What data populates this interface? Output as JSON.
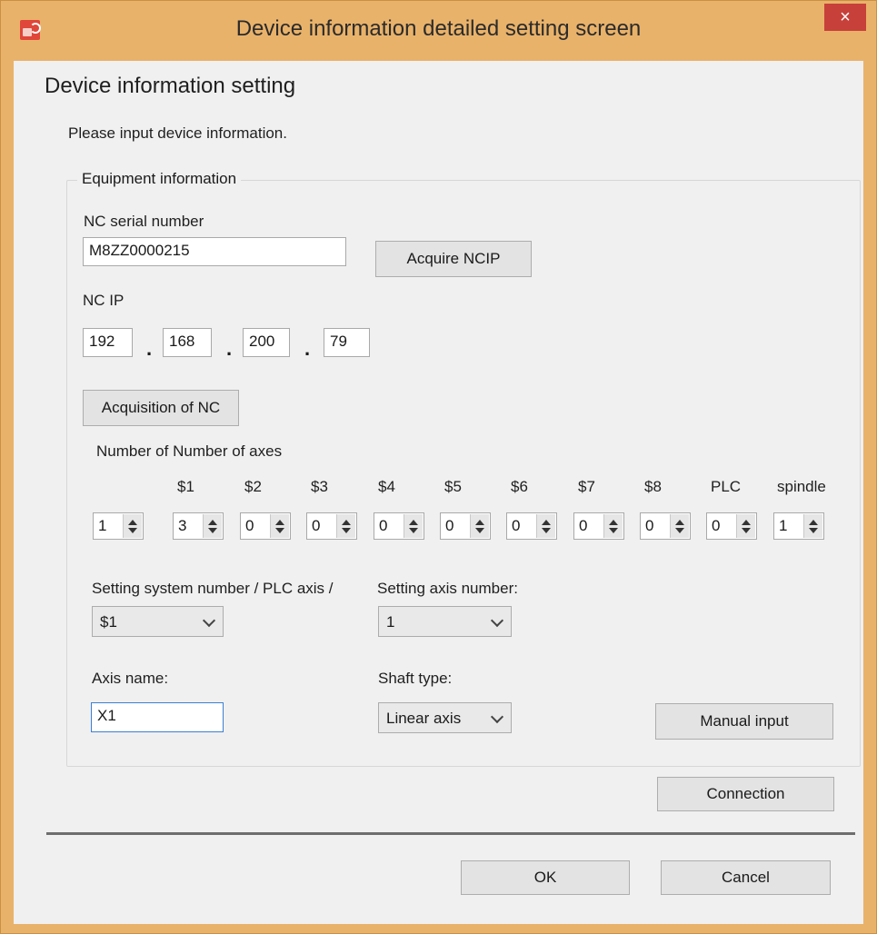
{
  "window": {
    "title": "Device information detailed setting screen",
    "close_glyph": "×"
  },
  "heading": "Device information setting",
  "instruction": "Please input device information.",
  "equipment": {
    "legend": "Equipment information",
    "serial_label": "NC serial number",
    "serial_value": "M8ZZ0000215",
    "acquire_ncip": "Acquire NCIP",
    "ip_label": "NC IP",
    "ip": [
      "192",
      "168",
      "200",
      "79"
    ],
    "ip_dot": ".",
    "acquisition_button": "Acquisition of NC",
    "axes_label": "Number of Number of axes",
    "axis_headers": [
      "$1",
      "$2",
      "$3",
      "$4",
      "$5",
      "$6",
      "$7",
      "$8",
      "PLC",
      "spindle"
    ],
    "spin_values": [
      "1",
      "3",
      "0",
      "0",
      "0",
      "0",
      "0",
      "0",
      "0",
      "0",
      "1"
    ],
    "system_label": "Setting system number / PLC axis /",
    "system_value": "$1",
    "axis_number_label": "Setting axis number:",
    "axis_number_value": "1",
    "axis_name_label": "Axis name:",
    "axis_name_value": "X1",
    "shaft_type_label": "Shaft type:",
    "shaft_type_value": "Linear axis",
    "manual_input": "Manual input"
  },
  "connection_button": "Connection",
  "ok_button": "OK",
  "cancel_button": "Cancel",
  "colors": {
    "title_bar": "#e9b26a",
    "close_button": "#c7403a",
    "client_bg": "#f0f0f0",
    "focus_border": "#3c7fd1"
  },
  "icons": [
    "app-icon",
    "close-icon",
    "chevron-down-icon",
    "spin-up-icon",
    "spin-down-icon"
  ]
}
